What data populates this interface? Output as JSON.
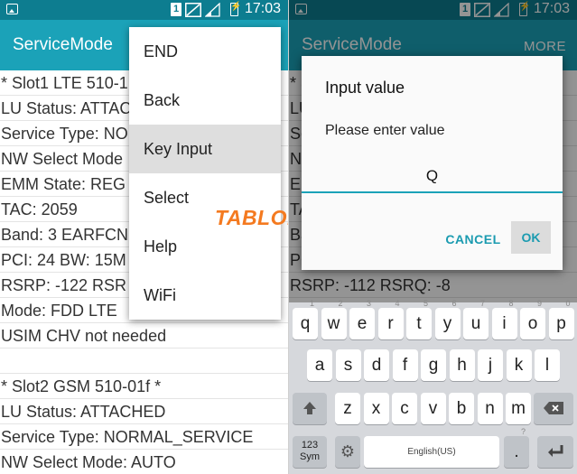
{
  "status": {
    "sim_label": "1",
    "time": "17:03"
  },
  "left": {
    "app_title": "ServiceMode",
    "rows": [
      "* Slot1 LTE 510-1",
      "LU Status: ATTAC",
      "Service Type: NO",
      "NW Select Mode",
      "EMM State: REG",
      "TAC: 2059",
      "Band: 3  EARFCN",
      "PCI: 24  BW: 15M",
      "RSRP: -122  RSR",
      "Mode: FDD LTE",
      "USIM CHV not needed",
      "",
      "* Slot2 GSM 510-01f *",
      "LU Status: ATTACHED",
      "Service Type: NORMAL_SERVICE",
      "NW Select Mode: AUTO"
    ],
    "menu": [
      {
        "label": "END"
      },
      {
        "label": "Back"
      },
      {
        "label": "Key Input",
        "selected": true
      },
      {
        "label": "Select"
      },
      {
        "label": "Help"
      },
      {
        "label": "WiFi"
      }
    ],
    "watermark": "TABLOIDTEKNO"
  },
  "right": {
    "app_title": "ServiceMode",
    "more_label": "MORE",
    "rows": [
      "* S",
      "LU",
      "Se",
      "NV",
      "EN",
      "TA",
      "Ba",
      "PC",
      "RSRP: -112  RSRQ: -8"
    ],
    "dialog": {
      "title": "Input value",
      "message": "Please enter value",
      "input_value": "Q",
      "cancel_label": "CANCEL",
      "ok_label": "OK"
    },
    "keyboard": {
      "row1": [
        {
          "k": "q",
          "h": "1"
        },
        {
          "k": "w",
          "h": "2"
        },
        {
          "k": "e",
          "h": "3"
        },
        {
          "k": "r",
          "h": "4"
        },
        {
          "k": "t",
          "h": "5"
        },
        {
          "k": "y",
          "h": "6"
        },
        {
          "k": "u",
          "h": "7"
        },
        {
          "k": "i",
          "h": "8"
        },
        {
          "k": "o",
          "h": "9"
        },
        {
          "k": "p",
          "h": "0"
        }
      ],
      "row2": [
        "a",
        "s",
        "d",
        "f",
        "g",
        "h",
        "j",
        "k",
        "l"
      ],
      "row3": [
        "z",
        "x",
        "c",
        "v",
        "b",
        "n",
        "m"
      ],
      "sym_label": "123\nSym",
      "space_label": "English(US)",
      "punct_label": ".",
      "punct_hint": "?"
    }
  }
}
